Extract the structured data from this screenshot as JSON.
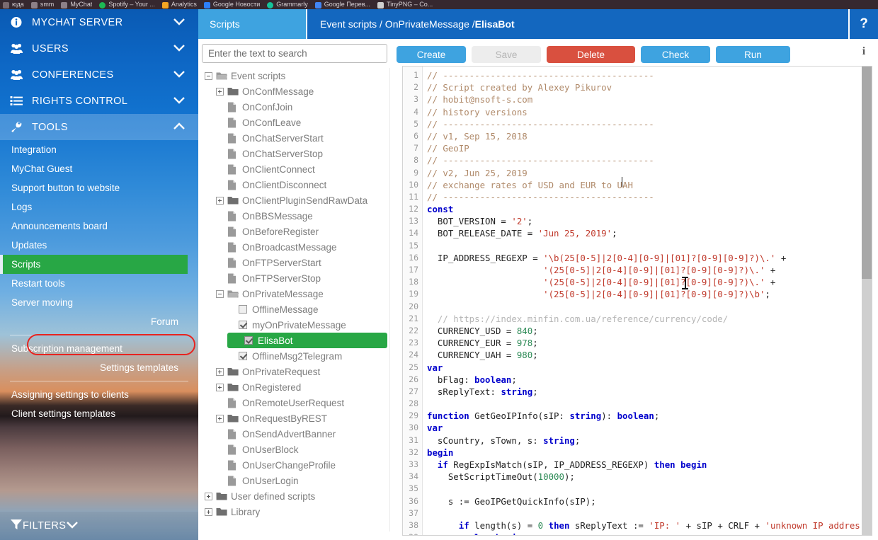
{
  "browser_tabs": [
    {
      "label": "юда",
      "favicon": "generic-icon",
      "color": "#7a6a70"
    },
    {
      "label": "smm",
      "favicon": "page-icon",
      "color": "#8d8088"
    },
    {
      "label": "MyChat",
      "favicon": "page-icon",
      "color": "#8d8088"
    },
    {
      "label": "Spotify – Your ...",
      "favicon": "spotify-icon",
      "color": "#1db954"
    },
    {
      "label": "Analytics",
      "favicon": "analytics-icon",
      "color": "#f5a623"
    },
    {
      "label": "Google Новости",
      "favicon": "google-news-icon",
      "color": "#2d7ff9"
    },
    {
      "label": "Grammarly",
      "favicon": "grammarly-icon",
      "color": "#15c39a"
    },
    {
      "label": "Google Перев...",
      "favicon": "google-translate-icon",
      "color": "#4285f4"
    },
    {
      "label": "TinyPNG – Co...",
      "favicon": "tinypng-icon",
      "color": "#cfcfcf"
    }
  ],
  "colors": {
    "brand_blue": "#1367bf",
    "tab_blue": "#3ea3e0",
    "button_blue": "#3ea3e0",
    "danger_red": "#d9503f",
    "selected_green": "#28a745",
    "oval_red": "#e8231f",
    "sidebar_blue": "#0d66c4"
  },
  "sidebar": {
    "main_items": [
      {
        "label": "MYCHAT SERVER",
        "icon": "info-circle-icon",
        "chevron": "chevron-down-icon",
        "active": false
      },
      {
        "label": "USERS",
        "icon": "users-icon",
        "chevron": "chevron-down-icon",
        "active": false
      },
      {
        "label": "CONFERENCES",
        "icon": "users-icon",
        "chevron": "chevron-down-icon",
        "active": false
      },
      {
        "label": "RIGHTS CONTROL",
        "icon": "list-icon",
        "chevron": "chevron-down-icon",
        "active": false
      },
      {
        "label": "TOOLS",
        "icon": "wrench-icon",
        "chevron": "chevron-up-icon",
        "active": true
      }
    ],
    "sub_items": [
      {
        "label": "Integration",
        "selected": false,
        "align": "left"
      },
      {
        "label": "MyChat Guest",
        "selected": false,
        "align": "left"
      },
      {
        "label": "Support button to website",
        "selected": false,
        "align": "left"
      },
      {
        "label": "Logs",
        "selected": false,
        "align": "left"
      },
      {
        "label": "Announcements board",
        "selected": false,
        "align": "left"
      },
      {
        "label": "Updates",
        "selected": false,
        "align": "left"
      },
      {
        "label": "Scripts",
        "selected": true,
        "align": "left"
      },
      {
        "label": "Restart tools",
        "selected": false,
        "align": "left"
      },
      {
        "label": "Server moving",
        "selected": false,
        "align": "left"
      },
      {
        "label": "Forum",
        "selected": false,
        "align": "right"
      }
    ],
    "sub_items_2": [
      {
        "label": "Subscription management",
        "selected": false,
        "align": "left"
      },
      {
        "label": "Settings templates",
        "selected": false,
        "align": "right"
      }
    ],
    "sub_items_3": [
      {
        "label": "Assigning settings to clients",
        "selected": false,
        "align": "left"
      },
      {
        "label": "Client settings templates",
        "selected": false,
        "align": "left"
      }
    ],
    "filters": {
      "label": "FILTERS",
      "icon": "filter-icon",
      "chevron": "chevron-down-icon"
    }
  },
  "header": {
    "tab_label": "Scripts",
    "breadcrumb_prefix": "Event scripts / OnPrivateMessage / ",
    "breadcrumb_current": "ElisaBot",
    "help_label": "?"
  },
  "search": {
    "placeholder": "Enter the text to search",
    "value": ""
  },
  "toolbar": {
    "buttons": [
      {
        "label": "Create",
        "style": "primary",
        "width": 98,
        "disabled": false
      },
      {
        "label": "Save",
        "style": "disabled",
        "width": 98,
        "disabled": true
      },
      {
        "label": "Delete",
        "style": "danger",
        "width": 125,
        "disabled": false
      },
      {
        "label": "Check",
        "style": "primary",
        "width": 98,
        "disabled": false
      },
      {
        "label": "Run",
        "style": "primary",
        "width": 105,
        "disabled": false
      }
    ],
    "info_label": "i"
  },
  "tree": {
    "nodes": [
      {
        "indent": 0,
        "toggle": "minus",
        "icon": "folder-open-icon",
        "label": "Event scripts",
        "selected": false
      },
      {
        "indent": 1,
        "toggle": "plus",
        "icon": "folder-icon",
        "label": "OnConfMessage",
        "selected": false
      },
      {
        "indent": 1,
        "toggle": "none",
        "icon": "file-icon",
        "label": "OnConfJoin",
        "selected": false
      },
      {
        "indent": 1,
        "toggle": "none",
        "icon": "file-icon",
        "label": "OnConfLeave",
        "selected": false
      },
      {
        "indent": 1,
        "toggle": "none",
        "icon": "file-icon",
        "label": "OnChatServerStart",
        "selected": false
      },
      {
        "indent": 1,
        "toggle": "none",
        "icon": "file-icon",
        "label": "OnChatServerStop",
        "selected": false
      },
      {
        "indent": 1,
        "toggle": "none",
        "icon": "file-icon",
        "label": "OnClientConnect",
        "selected": false
      },
      {
        "indent": 1,
        "toggle": "none",
        "icon": "file-icon",
        "label": "OnClientDisconnect",
        "selected": false
      },
      {
        "indent": 1,
        "toggle": "plus",
        "icon": "folder-icon",
        "label": "OnClientPluginSendRawData",
        "selected": false
      },
      {
        "indent": 1,
        "toggle": "none",
        "icon": "file-icon",
        "label": "OnBBSMessage",
        "selected": false
      },
      {
        "indent": 1,
        "toggle": "none",
        "icon": "file-icon",
        "label": "OnBeforeRegister",
        "selected": false
      },
      {
        "indent": 1,
        "toggle": "none",
        "icon": "file-icon",
        "label": "OnBroadcastMessage",
        "selected": false
      },
      {
        "indent": 1,
        "toggle": "none",
        "icon": "file-icon",
        "label": "OnFTPServerStart",
        "selected": false
      },
      {
        "indent": 1,
        "toggle": "none",
        "icon": "file-icon",
        "label": "OnFTPServerStop",
        "selected": false
      },
      {
        "indent": 1,
        "toggle": "minus",
        "icon": "folder-open-icon",
        "label": "OnPrivateMessage",
        "selected": false
      },
      {
        "indent": 2,
        "toggle": "none",
        "icon": "checkbox-unchecked",
        "label": "OfflineMessage",
        "selected": false
      },
      {
        "indent": 2,
        "toggle": "none",
        "icon": "checkbox-checked",
        "label": "myOnPrivateMessage",
        "selected": false
      },
      {
        "indent": 2,
        "toggle": "none",
        "icon": "checkbox-checked",
        "label": "ElisaBot",
        "selected": true
      },
      {
        "indent": 2,
        "toggle": "none",
        "icon": "checkbox-checked",
        "label": "OfflineMsg2Telegram",
        "selected": false
      },
      {
        "indent": 1,
        "toggle": "plus",
        "icon": "folder-icon",
        "label": "OnPrivateRequest",
        "selected": false
      },
      {
        "indent": 1,
        "toggle": "plus",
        "icon": "folder-icon",
        "label": "OnRegistered",
        "selected": false
      },
      {
        "indent": 1,
        "toggle": "none",
        "icon": "file-icon",
        "label": "OnRemoteUserRequest",
        "selected": false
      },
      {
        "indent": 1,
        "toggle": "plus",
        "icon": "folder-icon",
        "label": "OnRequestByREST",
        "selected": false
      },
      {
        "indent": 1,
        "toggle": "none",
        "icon": "file-icon",
        "label": "OnSendAdvertBanner",
        "selected": false
      },
      {
        "indent": 1,
        "toggle": "none",
        "icon": "file-icon",
        "label": "OnUserBlock",
        "selected": false
      },
      {
        "indent": 1,
        "toggle": "none",
        "icon": "file-icon",
        "label": "OnUserChangeProfile",
        "selected": false
      },
      {
        "indent": 1,
        "toggle": "none",
        "icon": "file-icon",
        "label": "OnUserLogin",
        "selected": false
      },
      {
        "indent": 0,
        "toggle": "plus",
        "icon": "folder-icon",
        "label": "User defined scripts",
        "selected": false
      },
      {
        "indent": 0,
        "toggle": "plus",
        "icon": "folder-icon",
        "label": "Library",
        "selected": false
      }
    ]
  },
  "editor": {
    "first_line_number": 1,
    "lines": [
      {
        "n": 1,
        "tokens": [
          {
            "t": "// ----------------------------------------",
            "c": "cm"
          }
        ]
      },
      {
        "n": 2,
        "tokens": [
          {
            "t": "// Script created by Alexey Pikurov",
            "c": "cm"
          }
        ]
      },
      {
        "n": 3,
        "tokens": [
          {
            "t": "// hobit@nsoft-s.com",
            "c": "cm"
          }
        ]
      },
      {
        "n": 4,
        "tokens": [
          {
            "t": "// history versions",
            "c": "cm"
          }
        ]
      },
      {
        "n": 5,
        "tokens": [
          {
            "t": "// ----------------------------------------",
            "c": "cm"
          }
        ]
      },
      {
        "n": 6,
        "tokens": [
          {
            "t": "// v1, Sep 15, 2018",
            "c": "cm"
          }
        ]
      },
      {
        "n": 7,
        "tokens": [
          {
            "t": "// GeoIP",
            "c": "cm"
          }
        ]
      },
      {
        "n": 8,
        "tokens": [
          {
            "t": "// ----------------------------------------",
            "c": "cm"
          }
        ]
      },
      {
        "n": 9,
        "tokens": [
          {
            "t": "// v2, Jun 25, 2019",
            "c": "cm"
          }
        ]
      },
      {
        "n": 10,
        "tokens": [
          {
            "t": "// exchange rates of USD and EUR to UAH",
            "c": "cm"
          }
        ]
      },
      {
        "n": 11,
        "tokens": [
          {
            "t": "// ----------------------------------------",
            "c": "cm"
          }
        ]
      },
      {
        "n": 12,
        "tokens": [
          {
            "t": "const",
            "c": "k"
          }
        ]
      },
      {
        "n": 13,
        "tokens": [
          {
            "t": "  BOT_VERSION = ",
            "c": "id"
          },
          {
            "t": "'2'",
            "c": "st"
          },
          {
            "t": ";",
            "c": "id"
          }
        ]
      },
      {
        "n": 14,
        "tokens": [
          {
            "t": "  BOT_RELEASE_DATE = ",
            "c": "id"
          },
          {
            "t": "'Jun 25, 2019'",
            "c": "st"
          },
          {
            "t": ";",
            "c": "id"
          }
        ]
      },
      {
        "n": 15,
        "tokens": [
          {
            "t": "",
            "c": "id"
          }
        ]
      },
      {
        "n": 16,
        "tokens": [
          {
            "t": "  IP_ADDRESS_REGEXP = ",
            "c": "id"
          },
          {
            "t": "'\\b(25[0-5]|2[0-4][0-9]|[01]?[0-9][0-9]?)\\.'",
            "c": "st"
          },
          {
            "t": " +",
            "c": "id"
          }
        ]
      },
      {
        "n": 17,
        "tokens": [
          {
            "t": "                      ",
            "c": "id"
          },
          {
            "t": "'(25[0-5]|2[0-4][0-9]|[01]?[0-9][0-9]?)\\.'",
            "c": "st"
          },
          {
            "t": " +",
            "c": "id"
          }
        ]
      },
      {
        "n": 18,
        "tokens": [
          {
            "t": "                      ",
            "c": "id"
          },
          {
            "t": "'(25[0-5]|2[0-4][0-9]|[01]?[0-9][0-9]?)\\.'",
            "c": "st"
          },
          {
            "t": " +",
            "c": "id"
          }
        ]
      },
      {
        "n": 19,
        "tokens": [
          {
            "t": "                      ",
            "c": "id"
          },
          {
            "t": "'(25[0-5]|2[0-4][0-9]|[01]?[0-9][0-9]?)\\b'",
            "c": "st"
          },
          {
            "t": ";",
            "c": "id"
          }
        ]
      },
      {
        "n": 20,
        "tokens": [
          {
            "t": "",
            "c": "id"
          }
        ]
      },
      {
        "n": 21,
        "tokens": [
          {
            "t": "  // https://index.minfin.com.ua/reference/currency/code/",
            "c": "cm2"
          }
        ]
      },
      {
        "n": 22,
        "tokens": [
          {
            "t": "  CURRENCY_USD = ",
            "c": "id"
          },
          {
            "t": "840",
            "c": "nm"
          },
          {
            "t": ";",
            "c": "id"
          }
        ]
      },
      {
        "n": 23,
        "tokens": [
          {
            "t": "  CURRENCY_EUR = ",
            "c": "id"
          },
          {
            "t": "978",
            "c": "nm"
          },
          {
            "t": ";",
            "c": "id"
          }
        ]
      },
      {
        "n": 24,
        "tokens": [
          {
            "t": "  CURRENCY_UAH = ",
            "c": "id"
          },
          {
            "t": "980",
            "c": "nm"
          },
          {
            "t": ";",
            "c": "id"
          }
        ]
      },
      {
        "n": 25,
        "tokens": [
          {
            "t": "var",
            "c": "k"
          }
        ]
      },
      {
        "n": 26,
        "tokens": [
          {
            "t": "  bFlag: ",
            "c": "id"
          },
          {
            "t": "boolean",
            "c": "k"
          },
          {
            "t": ";",
            "c": "id"
          }
        ]
      },
      {
        "n": 27,
        "tokens": [
          {
            "t": "  sReplyText: ",
            "c": "id"
          },
          {
            "t": "string",
            "c": "k"
          },
          {
            "t": ";",
            "c": "id"
          }
        ]
      },
      {
        "n": 28,
        "tokens": [
          {
            "t": "",
            "c": "id"
          }
        ]
      },
      {
        "n": 29,
        "tokens": [
          {
            "t": "function",
            "c": "k"
          },
          {
            "t": " GetGeoIPInfo(sIP: ",
            "c": "id"
          },
          {
            "t": "string",
            "c": "k"
          },
          {
            "t": "): ",
            "c": "id"
          },
          {
            "t": "boolean",
            "c": "k"
          },
          {
            "t": ";",
            "c": "id"
          }
        ]
      },
      {
        "n": 30,
        "tokens": [
          {
            "t": "var",
            "c": "k"
          }
        ]
      },
      {
        "n": 31,
        "tokens": [
          {
            "t": "  sCountry, sTown, s: ",
            "c": "id"
          },
          {
            "t": "string",
            "c": "k"
          },
          {
            "t": ";",
            "c": "id"
          }
        ]
      },
      {
        "n": 32,
        "tokens": [
          {
            "t": "begin",
            "c": "k"
          }
        ]
      },
      {
        "n": 33,
        "tokens": [
          {
            "t": "  ",
            "c": "id"
          },
          {
            "t": "if",
            "c": "k"
          },
          {
            "t": " RegExpIsMatch(sIP, IP_ADDRESS_REGEXP) ",
            "c": "id"
          },
          {
            "t": "then begin",
            "c": "k"
          }
        ]
      },
      {
        "n": 34,
        "tokens": [
          {
            "t": "    SetScriptTimeOut(",
            "c": "id"
          },
          {
            "t": "10000",
            "c": "nm"
          },
          {
            "t": ");",
            "c": "id"
          }
        ]
      },
      {
        "n": 35,
        "tokens": [
          {
            "t": "",
            "c": "id"
          }
        ]
      },
      {
        "n": 36,
        "tokens": [
          {
            "t": "    s := GeoIPGetQuickInfo(sIP);",
            "c": "id"
          }
        ]
      },
      {
        "n": 37,
        "tokens": [
          {
            "t": "",
            "c": "id"
          }
        ]
      },
      {
        "n": 38,
        "tokens": [
          {
            "t": "      ",
            "c": "id"
          },
          {
            "t": "if",
            "c": "k"
          },
          {
            "t": " length(s) = ",
            "c": "id"
          },
          {
            "t": "0",
            "c": "nm"
          },
          {
            "t": " ",
            "c": "id"
          },
          {
            "t": "then",
            "c": "k"
          },
          {
            "t": " sReplyText := ",
            "c": "id"
          },
          {
            "t": "'IP: '",
            "c": "st"
          },
          {
            "t": " + sIP + CRLF + ",
            "c": "id"
          },
          {
            "t": "'unknown IP addres",
            "c": "st"
          }
        ]
      },
      {
        "n": 39,
        "tokens": [
          {
            "t": "        ",
            "c": "id"
          },
          {
            "t": "else begin",
            "c": "k"
          }
        ]
      }
    ]
  }
}
